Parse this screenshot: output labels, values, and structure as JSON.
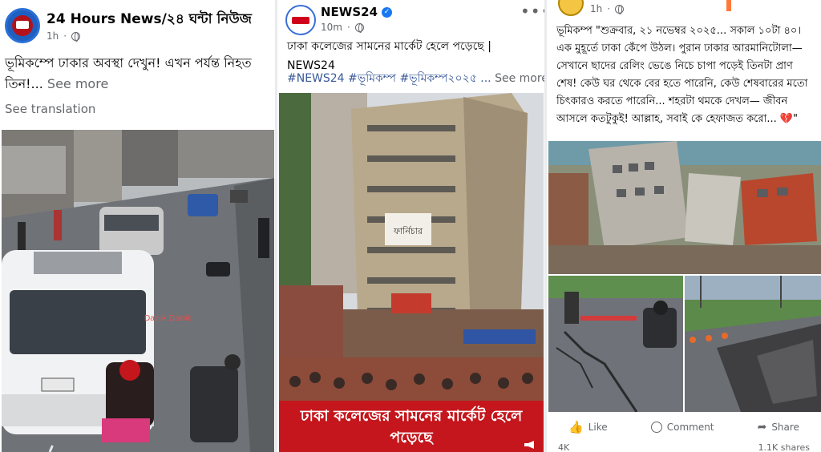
{
  "post1": {
    "page_name": "24 Hours News/২৪ ঘন্টা নিউজ",
    "time": "1h",
    "text": "ভূমিকম্পে ঢাকার অবস্থা দেখুন! এখন পর্যন্ত নিহত তিন!...",
    "see_more": "See more",
    "see_translation": "See translation",
    "watermark": "Dainik Dainik"
  },
  "post2": {
    "page_name": "NEWS24",
    "time": "10m",
    "text": "ঢাকা কলেজের সামনের মার্কেট হেলে পড়েছে | NEWS24",
    "hashtags": "#NEWS24 #ভূমিকম্প #ভূমিকম্প২০২৫ ...",
    "see_more": "See more",
    "caption": "ঢাকা কলেজের সামনের মার্কেট হেলে পড়েছে",
    "building_sign": "ফার্নিচার",
    "more_icon": "ellipsis-icon",
    "brand_color": "#d0021b"
  },
  "post3": {
    "time": "1h",
    "text": "ভূমিকম্প \"শুক্রবার, ২১ নভেম্বর ২০২৫... সকাল ১০টা ৪০। এক মুহূর্তে ঢাকা কেঁপে উঠল। পুরান ঢাকার আরমানিটোলা—সেখানে ছাদের রেলিং ভেঙে নিচে চাপা পড়েই তিনটা প্রাণ শেষ! কেউ ঘর থেকে বের হতে পারেনি, কেউ শেষবারের মতো চিৎকারও করতে পারেনি... শহরটা থমকে দেখল— জীবন আসলে কতটুকুই! আল্লাহ, সবাই কে হেফাজত করো... 💔\"",
    "like": "Like",
    "comment": "Comment",
    "share": "Share",
    "reactions_count": "4K",
    "shares_count": "1.1K shares"
  }
}
